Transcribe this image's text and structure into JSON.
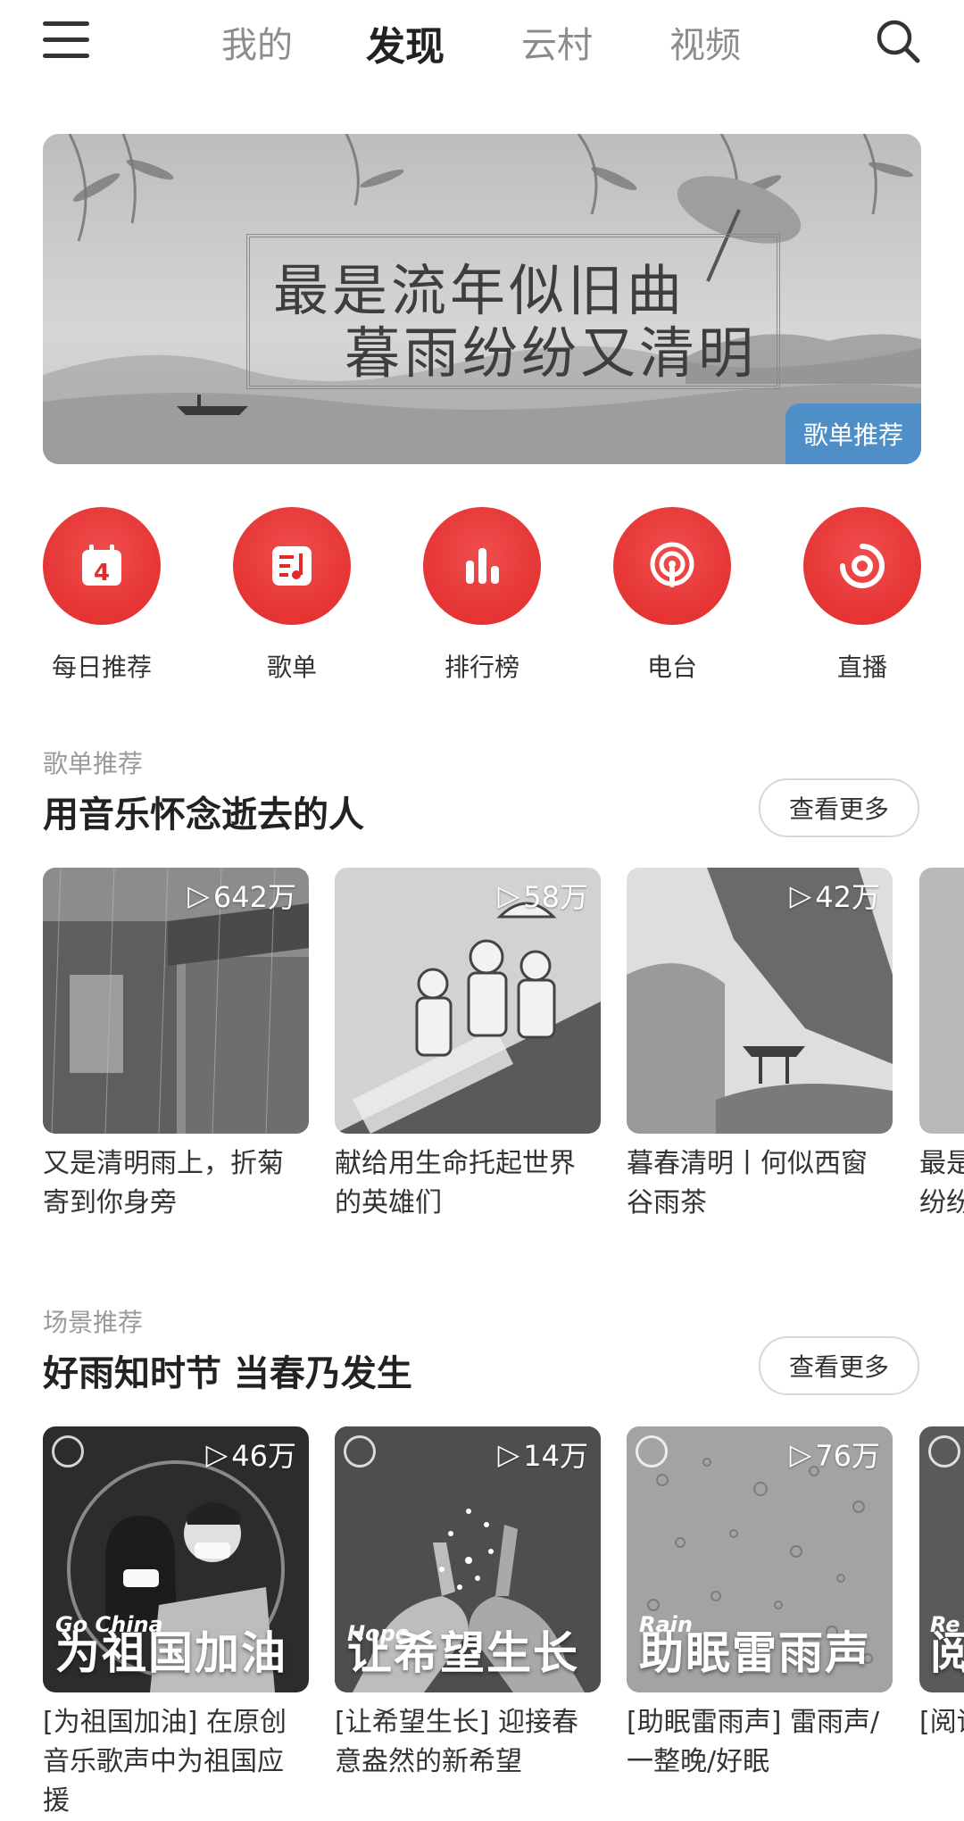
{
  "nav": {
    "tabs": [
      {
        "label": "我的"
      },
      {
        "label": "发现",
        "active": true
      },
      {
        "label": "云村"
      },
      {
        "label": "视频"
      }
    ],
    "menu_icon": "hamburger-icon",
    "search_icon": "search-icon"
  },
  "banner": {
    "line1": "最是流年似旧曲",
    "line2": "暮雨纷纷又清明",
    "badge": "歌单推荐"
  },
  "quick_entries": [
    {
      "label": "每日推荐",
      "icon": "calendar-icon",
      "calendar_day": "4"
    },
    {
      "label": "歌单",
      "icon": "playlist-icon"
    },
    {
      "label": "排行榜",
      "icon": "ranking-bars-icon"
    },
    {
      "label": "电台",
      "icon": "radio-podcast-icon"
    },
    {
      "label": "直播",
      "icon": "live-icon"
    }
  ],
  "playlist_section": {
    "subtitle": "歌单推荐",
    "title": "用音乐怀念逝去的人",
    "more_label": "查看更多",
    "cards": [
      {
        "count": "642万",
        "title": "又是清明雨上，折菊寄到你身旁"
      },
      {
        "count": "58万",
        "title": "献给用生命托起世界的英雄们"
      },
      {
        "count": "42万",
        "title": "暮春清明丨何似西窗谷雨茶"
      },
      {
        "count": "",
        "title": "最是流年似旧曲 暮雨纷纷又清明"
      }
    ]
  },
  "scene_section": {
    "subtitle": "场景推荐",
    "title": "好雨知时节 当春乃发生",
    "more_label": "查看更多",
    "cards": [
      {
        "count": "46万",
        "en": "Go China",
        "zh": "为祖国加油",
        "title": "[为祖国加油] 在原创音乐歌声中为祖国应援"
      },
      {
        "count": "14万",
        "en": "Hope",
        "zh": "让希望生长",
        "title": "[让希望生长] 迎接春意盎然的新希望"
      },
      {
        "count": "76万",
        "en": "Rain",
        "zh": "助眠雷雨声",
        "title": "[助眠雷雨声] 雷雨声/一整晚/好眠"
      },
      {
        "count": "",
        "en": "Re",
        "zh": "阅",
        "title": "[阅读] 的古"
      }
    ]
  }
}
